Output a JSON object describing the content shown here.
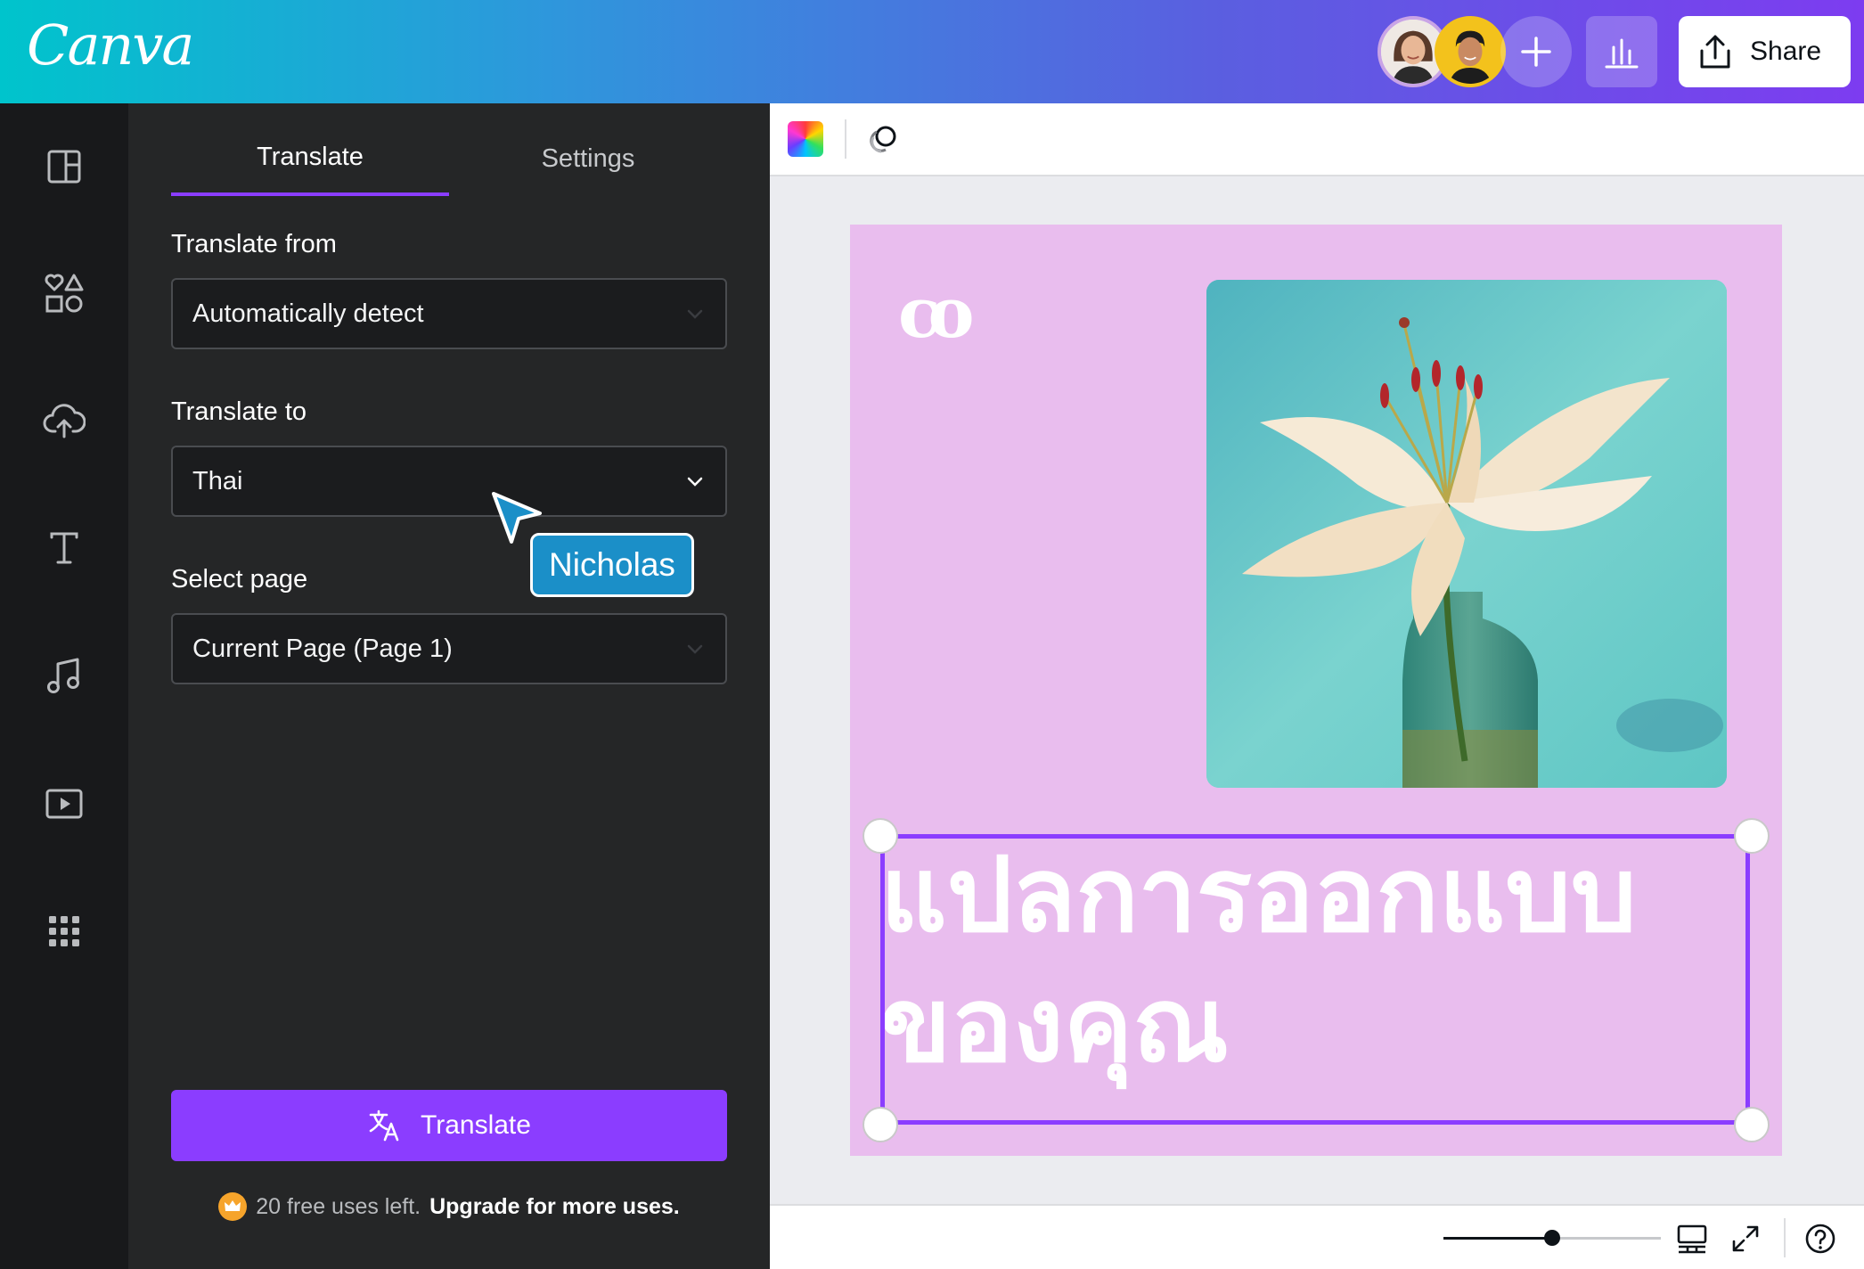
{
  "app": {
    "logo": "Canva"
  },
  "header": {
    "share_label": "Share",
    "collaborators": [
      {
        "name": "collaborator-1"
      },
      {
        "name": "collaborator-2"
      }
    ]
  },
  "rail": {
    "items": [
      {
        "icon": "templates-icon"
      },
      {
        "icon": "elements-icon"
      },
      {
        "icon": "uploads-icon"
      },
      {
        "icon": "text-icon"
      },
      {
        "icon": "audio-icon"
      },
      {
        "icon": "videos-icon"
      },
      {
        "icon": "apps-icon"
      }
    ]
  },
  "panel": {
    "tabs": [
      {
        "label": "Translate",
        "active": true
      },
      {
        "label": "Settings",
        "active": false
      }
    ],
    "translate_from": {
      "label": "Translate from",
      "value": "Automatically detect"
    },
    "translate_to": {
      "label": "Translate to",
      "value": "Thai"
    },
    "select_page": {
      "label": "Select page",
      "value": "Current Page (Page 1)"
    },
    "translate_button": "Translate",
    "uses": {
      "free_text": "20 free uses left.",
      "upgrade_text": "Upgrade for more uses."
    }
  },
  "cursor": {
    "user": "Nicholas",
    "color": "#1b8fc8"
  },
  "canvas": {
    "page_background": "#e9bdee",
    "brand_mark": "co",
    "headline": "แปลการออกแบบของคุณ"
  },
  "colors": {
    "accent": "#8b3dff",
    "panel": "#252627",
    "rail": "#18191b"
  },
  "footer": {
    "zoom_fraction": 0.5
  }
}
